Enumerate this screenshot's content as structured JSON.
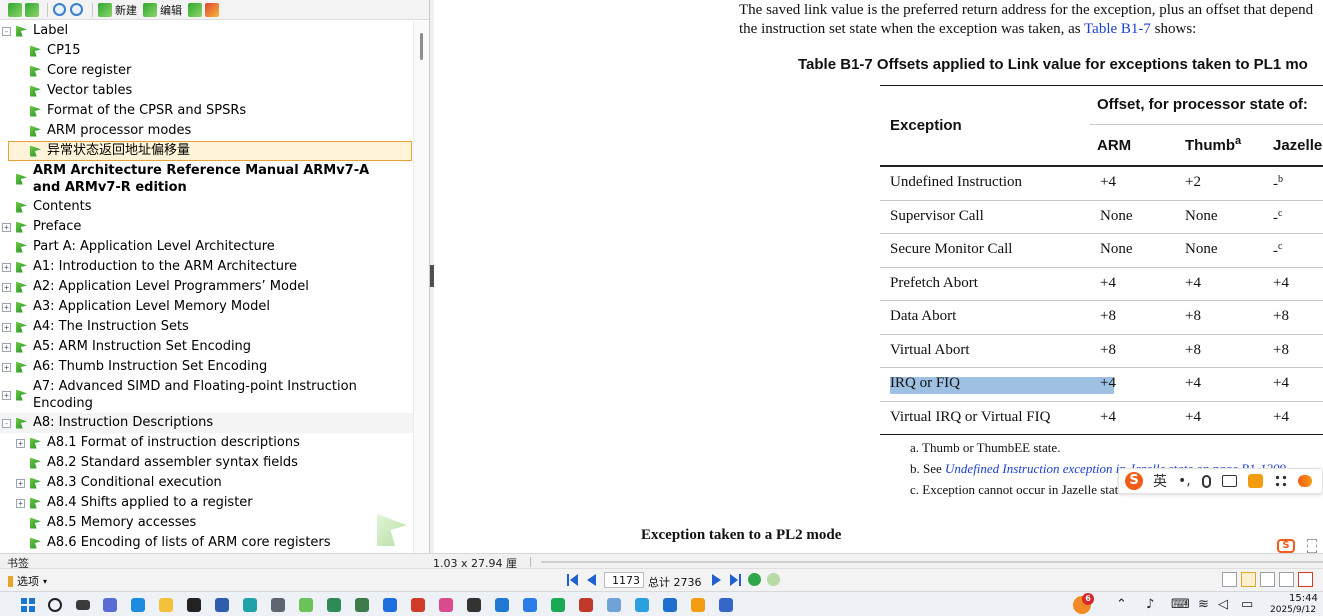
{
  "toolbar": {
    "new_label": "新建",
    "edit_label": "编辑"
  },
  "bookmarks": [
    {
      "label": "Label",
      "level": 0,
      "expander": "-"
    },
    {
      "label": "CP15",
      "level": 1
    },
    {
      "label": "Core register",
      "level": 1
    },
    {
      "label": "Vector tables",
      "level": 1
    },
    {
      "label": "Format of the CPSR and SPSRs",
      "level": 1
    },
    {
      "label": "ARM processor modes",
      "level": 1
    },
    {
      "label": "异常状态返回地址偏移量",
      "level": 1,
      "selected": true
    },
    {
      "label": "ARM Architecture Reference Manual ARMv7-A and ARMv7-R edition",
      "level": 0,
      "bold": true,
      "tall": true
    },
    {
      "label": "Contents",
      "level": 0
    },
    {
      "label": "Preface",
      "level": 0,
      "expander": "+"
    },
    {
      "label": "Part A: Application Level Architecture",
      "level": 0
    },
    {
      "label": "A1: Introduction to the ARM Architecture",
      "level": 0,
      "expander": "+"
    },
    {
      "label": "A2: Application Level Programmers’ Model",
      "level": 0,
      "expander": "+"
    },
    {
      "label": "A3: Application Level Memory Model",
      "level": 0,
      "expander": "+"
    },
    {
      "label": "A4: The Instruction Sets",
      "level": 0,
      "expander": "+"
    },
    {
      "label": "A5: ARM Instruction Set Encoding",
      "level": 0,
      "expander": "+"
    },
    {
      "label": "A6: Thumb Instruction Set Encoding",
      "level": 0,
      "expander": "+"
    },
    {
      "label": "A7: Advanced SIMD and Floating-point Instruction Encoding",
      "level": 0,
      "expander": "+",
      "tall": true
    },
    {
      "label": "A8: Instruction Descriptions",
      "level": 0,
      "expander": "-"
    },
    {
      "label": "A8.1 Format of instruction descriptions",
      "level": 1,
      "expander": "+"
    },
    {
      "label": "A8.2 Standard assembler syntax fields",
      "level": 1
    },
    {
      "label": "A8.3 Conditional execution",
      "level": 1,
      "expander": "+"
    },
    {
      "label": "A8.4 Shifts applied to a register",
      "level": 1,
      "expander": "+"
    },
    {
      "label": "A8.5 Memory accesses",
      "level": 1
    },
    {
      "label": "A8.6 Encoding of lists of ARM core registers",
      "level": 1
    }
  ],
  "document": {
    "para_line1": "The saved link value is the preferred return address for the exception, plus an offset that depend",
    "para_line2_prefix": "the instruction set state when the exception was taken, as ",
    "para_line2_link": "Table B1-7",
    "para_line2_suffix": " shows:",
    "table_title": "Table B1-7 Offsets applied to Link value for exceptions taken to PL1 mo",
    "header_exception": "Exception",
    "header_offset": "Offset, for processor state of:",
    "col_arm": "ARM",
    "col_thumb": "Thumb",
    "col_thumb_sup": "a",
    "col_jazelle": "Jazelle",
    "rows": [
      {
        "exception": "Undefined Instruction",
        "arm": "+4",
        "thumb": "+2",
        "jazelle": "-",
        "jazelle_sup": "b"
      },
      {
        "exception": "Supervisor Call",
        "arm": "None",
        "thumb": "None",
        "jazelle": "-",
        "jazelle_sup": "c"
      },
      {
        "exception": "Secure Monitor Call",
        "arm": "None",
        "thumb": "None",
        "jazelle": "-",
        "jazelle_sup": "c"
      },
      {
        "exception": "Prefetch Abort",
        "arm": "+4",
        "thumb": "+4",
        "jazelle": "+4",
        "jazelle_sup": ""
      },
      {
        "exception": "Data Abort",
        "arm": "+8",
        "thumb": "+8",
        "jazelle": "+8",
        "jazelle_sup": ""
      },
      {
        "exception": "Virtual Abort",
        "arm": "+8",
        "thumb": "+8",
        "jazelle": "+8",
        "jazelle_sup": ""
      },
      {
        "exception": "IRQ or FIQ",
        "arm": "+4",
        "thumb": "+4",
        "jazelle": "+4",
        "jazelle_sup": ""
      },
      {
        "exception": "Virtual IRQ or Virtual FIQ",
        "arm": "+4",
        "thumb": "+4",
        "jazelle": "+4",
        "jazelle_sup": ""
      }
    ],
    "note_a": "a.  Thumb or ThumbEE state.",
    "note_b_prefix": "b.  See ",
    "note_b_link": "Undefined Instruction exception in Jazelle state on page B1-1209",
    "note_c": "c.  Exception cannot occur in Jazelle state.",
    "pl2_heading": "Exception taken to a PL2 mode"
  },
  "ime": {
    "lang": "英",
    "punct": "•,"
  },
  "status": {
    "bookmarks_label": "书签",
    "size": "1.03 x 27.94 厘"
  },
  "nav": {
    "options_label": "选项",
    "page_current": "1173",
    "page_total": "总计 2736"
  },
  "clock": {
    "time": "15:44",
    "date": "2025/9/12"
  },
  "tray": {
    "badge": "6"
  }
}
